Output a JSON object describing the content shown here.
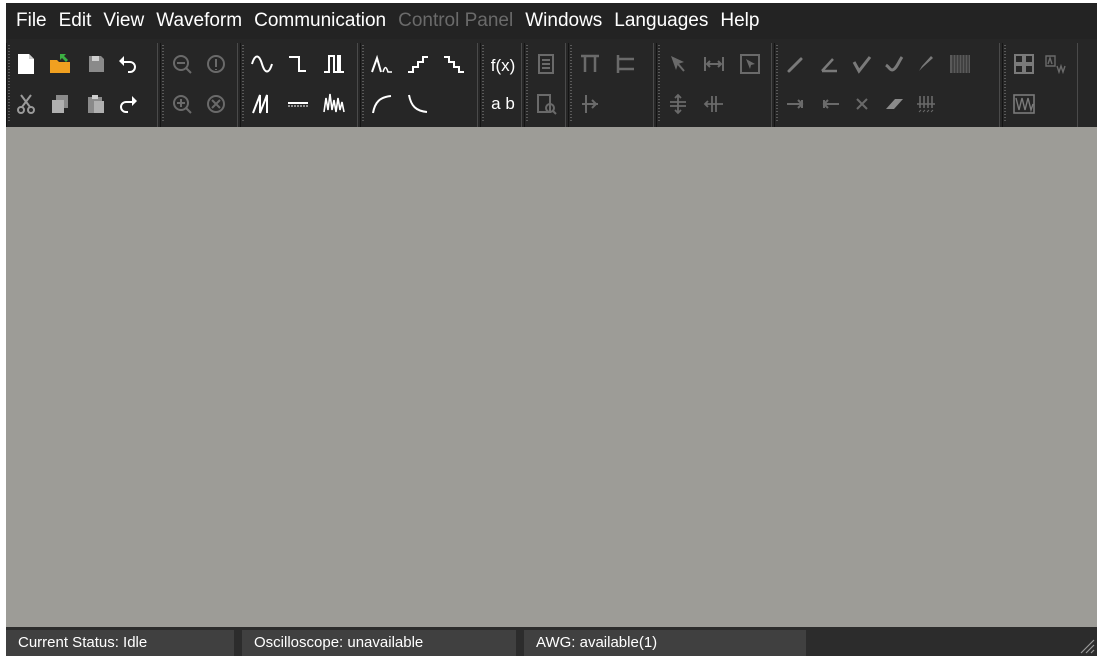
{
  "menu": {
    "items": [
      "File",
      "Edit",
      "View",
      "Waveform",
      "Communication",
      "Control Panel",
      "Windows",
      "Languages",
      "Help"
    ],
    "disabled": [
      "Control Panel"
    ]
  },
  "toolbar": {
    "fx_label": "f(x)",
    "ab_label": "a b",
    "icons": [
      "new-file",
      "open-folder",
      "save",
      "undo",
      "cut",
      "copy",
      "paste",
      "redo",
      "zoom-out",
      "zoom-fit",
      "zoom-in",
      "zoom-reset",
      "sine-wave",
      "pulse-wave",
      "square-wave",
      "sawtooth-wave",
      "dc-line",
      "noise-wave",
      "gaussian-pulse",
      "staircase-up",
      "staircase-down",
      "exponential-rise",
      "exponential-decay",
      "equation",
      "text-label",
      "properties",
      "inspect",
      "marker-top",
      "marker-left",
      "marker-merge",
      "select-arrow",
      "fit-width",
      "select-region",
      "align-vertical",
      "align-horizontal",
      "pencil",
      "line-draw",
      "check-draw",
      "smooth-draw",
      "brush-draw",
      "grid",
      "arrow-right-line",
      "arrow-left-line",
      "delete-x",
      "eraser",
      "sample-points",
      "layout-grid",
      "waveform-window",
      "waveform-overview"
    ]
  },
  "status": {
    "current": "Current Status: Idle",
    "oscilloscope": "Oscilloscope: unavailable",
    "awg": "AWG: available(1)"
  },
  "colors": {
    "menubar": "#232323",
    "toolbar": "#262626",
    "workarea": "#9d9c97",
    "statusbar": "#2c2c2c",
    "status_panel": "#404040",
    "icon_white": "#ffffff",
    "icon_grey": "#9a9a9a",
    "icon_orange": "#f0a020",
    "icon_green": "#3cb043"
  }
}
